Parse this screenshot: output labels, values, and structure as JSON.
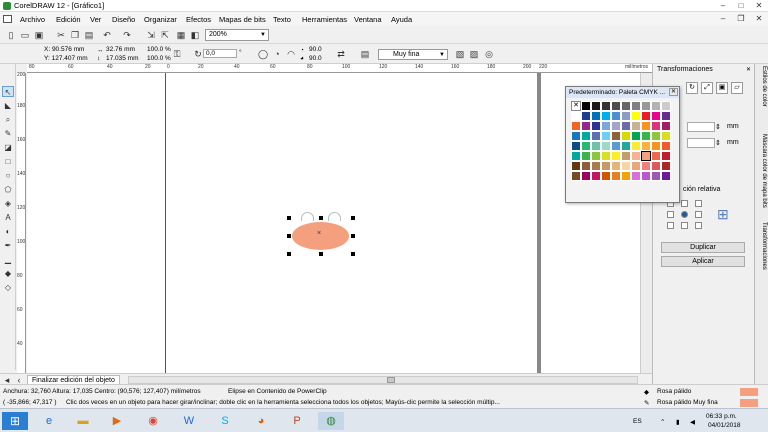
{
  "window": {
    "title": "CorelDRAW 12 - [Gráfico1]"
  },
  "menu": [
    "Archivo",
    "Edición",
    "Ver",
    "Diseño",
    "Organizar",
    "Efectos",
    "Mapas de bits",
    "Texto",
    "Herramientas",
    "Ventana",
    "Ayuda"
  ],
  "toolbar": {
    "zoom_value": "200%"
  },
  "propbar": {
    "x": "X:  90.576 mm",
    "y": "Y:  127.407 mm",
    "width": "32.76 mm",
    "height": "17.035 mm",
    "scale_x": "100.0",
    "scale_y": "100.0",
    "pct1": "%",
    "pct2": "%",
    "angle": "0,0",
    "angle_unit": "°",
    "arc_start": "90.0",
    "arc_end": "90.0",
    "line_width": "Muy fina"
  },
  "rulers": {
    "h_labels": [
      "80",
      "60",
      "40",
      "20",
      "0",
      "20",
      "40",
      "60",
      "80",
      "100",
      "120",
      "140",
      "160",
      "180",
      "200",
      "220"
    ],
    "h_unit": "milímetros",
    "v_labels": [
      "200",
      "180",
      "160",
      "140",
      "120",
      "100",
      "80",
      "60",
      "40",
      "20",
      "0"
    ],
    "v_unit": "milímetros"
  },
  "page": {
    "tab_label": "Finalizar edición del objeto"
  },
  "status": {
    "line1": "Anchura: 32,760  Altura: 17,035  Centro: (90,576; 127,407)  milímetros",
    "object_desc": "Elipse en Contenido de PowerClip",
    "line2_coords": "( -35,866; 47,317 )",
    "hint": "Clic dos veces en un objeto para hacer girar/inclinar; doble clic en la herramienta selecciona todos los objetos; Mayús-clic permite la selección múltip...",
    "fill_name": "Rosa pálido",
    "outline_name": "Rosa pálido  Muy fina",
    "swatch_color": "#f4a07e"
  },
  "docker": {
    "title": "Transformaciones",
    "unit1": "mm",
    "unit2": "mm",
    "relative_label": "ción relativa",
    "duplicate": "Duplicar",
    "apply": "Aplicar",
    "side_tabs": [
      "Estilos de color",
      "Máscara color de mapa bits",
      "Transformaciones"
    ]
  },
  "palette": {
    "title": "Predeterminado: Paleta CMYK ...",
    "colors": [
      "nofill",
      "#000000",
      "#1a1a1a",
      "#333333",
      "#4d4d4d",
      "#666666",
      "#808080",
      "#999999",
      "#b3b3b3",
      "#cccccc",
      "#ffffff",
      "#1c3f94",
      "#0072bc",
      "#00aeef",
      "#4a8fd6",
      "#8b9dc3",
      "#ffff00",
      "#ed1c24",
      "#ec008c",
      "#662d91",
      "#f26522",
      "#92278f",
      "#2e3192",
      "#7da7d9",
      "#a3a3cc",
      "#6c6ca8",
      "#c7b299",
      "#f7941d",
      "#e0317e",
      "#9e1f63",
      "#1b75bb",
      "#00a99d",
      "#5c6fb5",
      "#6dcff6",
      "#8c6239",
      "#d8d800",
      "#00a651",
      "#39b54a",
      "#8dc63f",
      "#d7df23",
      "#0f4c81",
      "#2bb673",
      "#6bc4a6",
      "#a0d8c5",
      "#5a9bd4",
      "#26a69a",
      "#f9ed32",
      "#fbb040",
      "#f7941e",
      "#f15a29",
      "#00a79d",
      "#39b54a",
      "#8cc63f",
      "#d9e021",
      "#fcee21",
      "#c69c6d",
      "#f8b195",
      "#f4a07e",
      "#ee6a4a",
      "#be1e2d",
      "#603913",
      "#8b5e3c",
      "#a97c50",
      "#c49a6c",
      "#e4b47d",
      "#f5d5a8",
      "#e8a87c",
      "#f08080",
      "#d95b5b",
      "#a52a2a",
      "#754c24",
      "#9e005d",
      "#c2185b",
      "#d35400",
      "#e67e22",
      "#f0a30a",
      "#da70d6",
      "#ba55d3",
      "#9b59b6",
      "#6a1b9a"
    ],
    "selected_index": 57
  },
  "taskbar": {
    "lang": "ES",
    "time": "06:33 p.m.",
    "date": "04/01/2018"
  }
}
